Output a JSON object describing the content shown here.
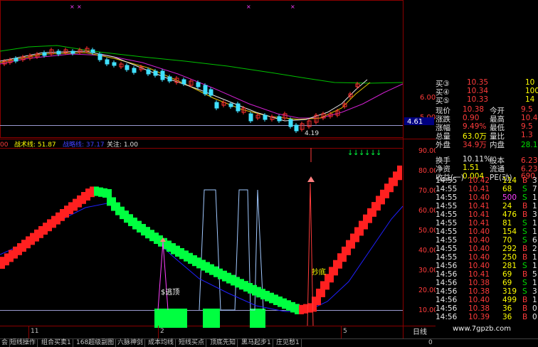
{
  "price_labels": {
    "p1": "6.00",
    "p2": "5.00",
    "current": "4.61",
    "low_mark": "4.19"
  },
  "indicator_header": {
    "lead": "00",
    "label1": "战术线: 51.87",
    "label2": "战略线: 37.17",
    "label3": "关注: 1.00"
  },
  "indicator_axis": [
    "90.00",
    "80.00",
    "70.00",
    "60.00",
    "50.00",
    "40.00",
    "30.00",
    "20.00",
    "10.00"
  ],
  "annotations": {
    "escape": "$逃顶",
    "bottom": "抄底"
  },
  "time_axis": {
    "t1": "11",
    "t2": "2",
    "t3": "5",
    "period": "日线",
    "zero": "0"
  },
  "order_book": [
    {
      "label": "买③",
      "price": "10.35",
      "vol": "10"
    },
    {
      "label": "买④",
      "price": "10.34",
      "vol": "100"
    },
    {
      "label": "买⑤",
      "price": "10.33",
      "vol": "14"
    }
  ],
  "stats": [
    {
      "l1": "现价",
      "v1": "10.38",
      "l2": "今开",
      "v2": "9.5"
    },
    {
      "l1": "涨跌",
      "v1": "0.90",
      "l2": "最高",
      "v2": "10.4"
    },
    {
      "l1": "涨幅",
      "v1": "9.49%",
      "l2": "最低",
      "v2": "9.5"
    },
    {
      "l1": "总量",
      "v1": "63.0万",
      "l2": "量比",
      "v2": "1.3"
    },
    {
      "l1": "外盘",
      "v1": "34.9万",
      "l2": "内盘",
      "v2": "28.1万"
    },
    {
      "l1": "换手",
      "v1": "10.11%",
      "l2": "股本",
      "v2": "6.23亿"
    },
    {
      "l1": "净资",
      "v1": "1.51",
      "l2": "流通",
      "v2": "6.23亿"
    },
    {
      "l1": "收益(一)",
      "v1": "0.004",
      "l2": "PE(动)",
      "v2": "690."
    }
  ],
  "ticks": [
    {
      "time": "14:55",
      "price": "10.42",
      "vol": "114",
      "side": "B",
      "n": "3"
    },
    {
      "time": "14:55",
      "price": "10.41",
      "vol": "68",
      "side": "S",
      "n": "7"
    },
    {
      "time": "14:55",
      "price": "10.40",
      "vol": "500",
      "side": "S",
      "n": "1"
    },
    {
      "time": "14:55",
      "price": "10.41",
      "vol": "24",
      "side": "B",
      "n": "1"
    },
    {
      "time": "14:55",
      "price": "10.41",
      "vol": "476",
      "side": "B",
      "n": "3"
    },
    {
      "time": "14:55",
      "price": "10.41",
      "vol": "81",
      "side": "S",
      "n": "1"
    },
    {
      "time": "14:55",
      "price": "10.40",
      "vol": "154",
      "side": "S",
      "n": "1"
    },
    {
      "time": "14:55",
      "price": "10.40",
      "vol": "70",
      "side": "S",
      "n": "6"
    },
    {
      "time": "14:55",
      "price": "10.40",
      "vol": "292",
      "side": "B",
      "n": "2"
    },
    {
      "time": "14:55",
      "price": "10.40",
      "vol": "250",
      "side": "B",
      "n": "1"
    },
    {
      "time": "14:56",
      "price": "10.40",
      "vol": "281",
      "side": "S",
      "n": "1"
    },
    {
      "time": "14:56",
      "price": "10.41",
      "vol": "69",
      "side": "B",
      "n": "5"
    },
    {
      "time": "14:56",
      "price": "10.38",
      "vol": "69",
      "side": "S",
      "n": "1"
    },
    {
      "time": "14:56",
      "price": "10.38",
      "vol": "319",
      "side": "S",
      "n": "3"
    },
    {
      "time": "14:56",
      "price": "10.40",
      "vol": "499",
      "side": "B",
      "n": "1"
    },
    {
      "time": "14:56",
      "price": "10.38",
      "vol": "36",
      "side": "B",
      "n": "0"
    },
    {
      "time": "14:56",
      "price": "10.39",
      "vol": "36",
      "side": "B",
      "n": "0"
    }
  ],
  "tabs": [
    "会",
    "短线操作",
    "组合买卖1",
    "168超级副图",
    "六脉神剑",
    "成本均线",
    "短线买点",
    "顶底先知",
    "黑马起步1",
    "庄见愁1"
  ],
  "watermark": "www.7gpzb.com",
  "colors": {
    "up": "#ff2020",
    "down": "#00ff40",
    "accent": "#ff3b3b"
  }
}
